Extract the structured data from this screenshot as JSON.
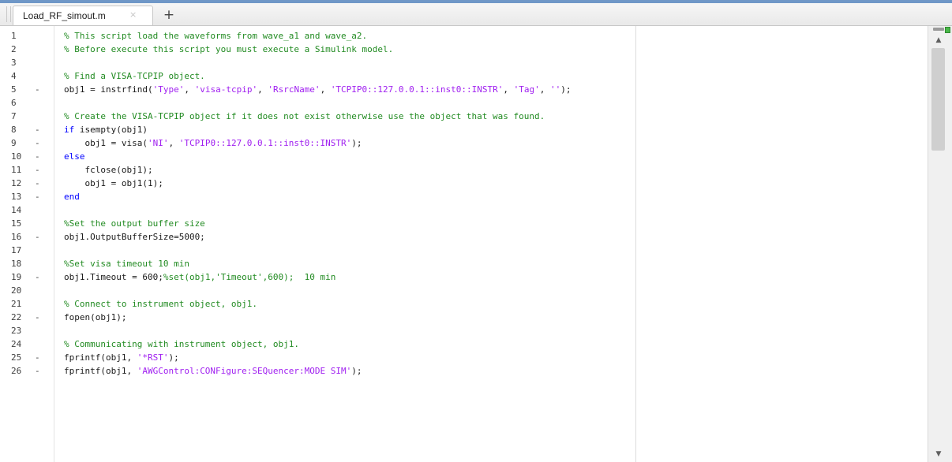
{
  "editor": {
    "tabs": [
      {
        "label": "Load_RF_simout.m",
        "close": "×"
      }
    ],
    "add_tab_label": "+",
    "lines": [
      {
        "n": "1",
        "dash": "",
        "segments": [
          [
            "comment",
            "% This script load the waveforms from wave_a1 and wave_a2."
          ]
        ]
      },
      {
        "n": "2",
        "dash": "",
        "segments": [
          [
            "comment",
            "% Before execute this script you must execute a Simulink model."
          ]
        ]
      },
      {
        "n": "3",
        "dash": "",
        "segments": []
      },
      {
        "n": "4",
        "dash": "",
        "segments": [
          [
            "comment",
            "% Find a VISA-TCPIP object."
          ]
        ]
      },
      {
        "n": "5",
        "dash": "-",
        "segments": [
          [
            "plain",
            "obj1 = instrfind("
          ],
          [
            "string",
            "'Type'"
          ],
          [
            "plain",
            ", "
          ],
          [
            "string",
            "'visa-tcpip'"
          ],
          [
            "plain",
            ", "
          ],
          [
            "string",
            "'RsrcName'"
          ],
          [
            "plain",
            ", "
          ],
          [
            "string",
            "'TCPIP0::127.0.0.1::inst0::INSTR'"
          ],
          [
            "plain",
            ", "
          ],
          [
            "string",
            "'Tag'"
          ],
          [
            "plain",
            ", "
          ],
          [
            "string",
            "''"
          ],
          [
            "plain",
            ");"
          ]
        ]
      },
      {
        "n": "6",
        "dash": "",
        "segments": []
      },
      {
        "n": "7",
        "dash": "",
        "segments": [
          [
            "comment",
            "% Create the VISA-TCPIP object if it does not exist otherwise use the object that was found."
          ]
        ]
      },
      {
        "n": "8",
        "dash": "-",
        "segments": [
          [
            "keyword",
            "if"
          ],
          [
            "plain",
            " isempty(obj1)"
          ]
        ]
      },
      {
        "n": "9",
        "dash": "-",
        "segments": [
          [
            "plain",
            "    obj1 = visa("
          ],
          [
            "string",
            "'NI'"
          ],
          [
            "plain",
            ", "
          ],
          [
            "string",
            "'TCPIP0::127.0.0.1::inst0::INSTR'"
          ],
          [
            "plain",
            ");"
          ]
        ]
      },
      {
        "n": "10",
        "dash": "-",
        "segments": [
          [
            "keyword",
            "else"
          ]
        ]
      },
      {
        "n": "11",
        "dash": "-",
        "segments": [
          [
            "plain",
            "    fclose(obj1);"
          ]
        ]
      },
      {
        "n": "12",
        "dash": "-",
        "segments": [
          [
            "plain",
            "    obj1 = obj1(1);"
          ]
        ]
      },
      {
        "n": "13",
        "dash": "-",
        "segments": [
          [
            "keyword",
            "end"
          ]
        ]
      },
      {
        "n": "14",
        "dash": "",
        "segments": []
      },
      {
        "n": "15",
        "dash": "",
        "segments": [
          [
            "comment",
            "%Set the output buffer size"
          ]
        ]
      },
      {
        "n": "16",
        "dash": "-",
        "segments": [
          [
            "plain",
            "obj1.OutputBufferSize=5000;"
          ]
        ]
      },
      {
        "n": "17",
        "dash": "",
        "segments": []
      },
      {
        "n": "18",
        "dash": "",
        "segments": [
          [
            "comment",
            "%Set visa timeout 10 min"
          ]
        ]
      },
      {
        "n": "19",
        "dash": "-",
        "segments": [
          [
            "plain",
            "obj1.Timeout = 600;"
          ],
          [
            "comment",
            "%set(obj1,'Timeout',600);  10 min"
          ]
        ]
      },
      {
        "n": "20",
        "dash": "",
        "segments": []
      },
      {
        "n": "21",
        "dash": "",
        "segments": [
          [
            "comment",
            "% Connect to instrument object, obj1."
          ]
        ]
      },
      {
        "n": "22",
        "dash": "-",
        "segments": [
          [
            "plain",
            "fopen(obj1);"
          ]
        ]
      },
      {
        "n": "23",
        "dash": "",
        "segments": []
      },
      {
        "n": "24",
        "dash": "",
        "segments": [
          [
            "comment",
            "% Communicating with instrument object, obj1."
          ]
        ]
      },
      {
        "n": "25",
        "dash": "-",
        "segments": [
          [
            "plain",
            "fprintf(obj1, "
          ],
          [
            "string",
            "'*RST'"
          ],
          [
            "plain",
            ");"
          ]
        ]
      },
      {
        "n": "26",
        "dash": "-",
        "segments": [
          [
            "plain",
            "fprintf(obj1, "
          ],
          [
            "string",
            "'AWGControl:CONFigure:SEQuencer:MODE SIM'"
          ],
          [
            "plain",
            ");"
          ]
        ]
      }
    ]
  },
  "scrollbar": {
    "up_glyph": "▲",
    "down_glyph": "▼",
    "status_color": "#49b749"
  },
  "colors": {
    "comment": "#228b22",
    "string": "#a020f0",
    "keyword": "#0000ff",
    "tab_accent": "#6f97c7"
  }
}
